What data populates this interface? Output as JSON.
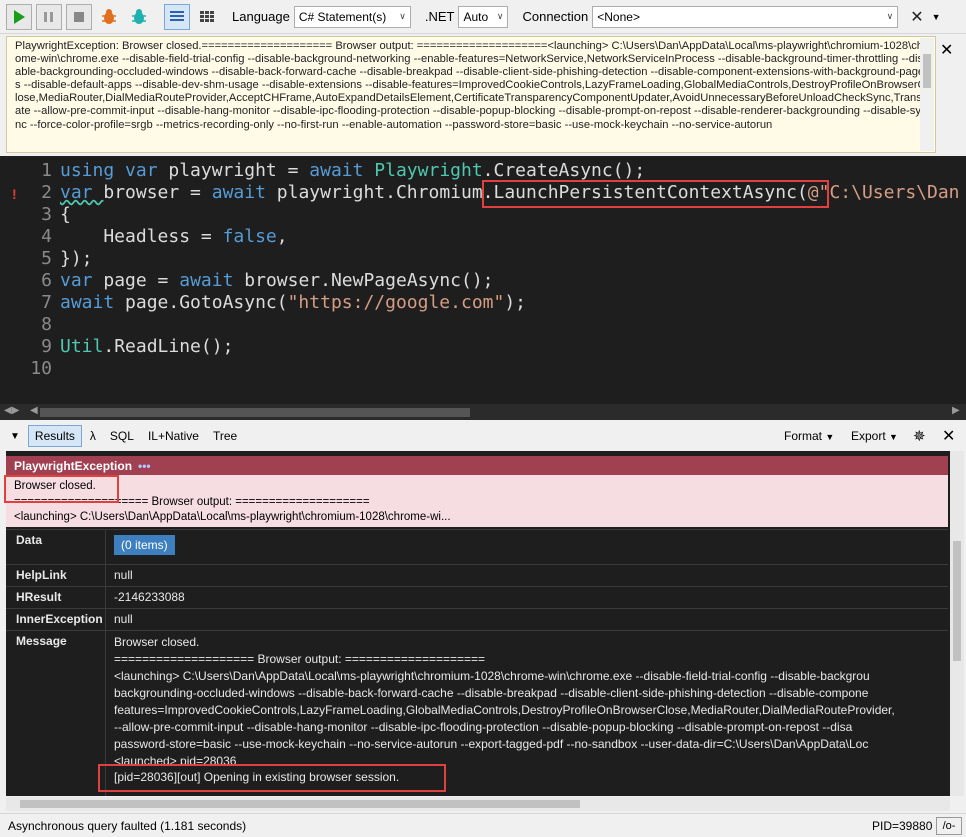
{
  "toolbar": {
    "language_label": "Language",
    "language_value": "C# Statement(s)",
    "dotnet_label": ".NET",
    "dotnet_value": "Auto",
    "connection_label": "Connection",
    "connection_value": "<None>"
  },
  "error_text": "PlaywrightException: Browser closed.==================== Browser output: ====================<launching> C:\\Users\\Dan\\AppData\\Local\\ms-playwright\\chromium-1028\\chrome-win\\chrome.exe --disable-field-trial-config --disable-background-networking --enable-features=NetworkService,NetworkServiceInProcess --disable-background-timer-throttling --disable-backgrounding-occluded-windows --disable-back-forward-cache --disable-breakpad --disable-client-side-phishing-detection --disable-component-extensions-with-background-pages --disable-default-apps --disable-dev-shm-usage --disable-extensions --disable-features=ImprovedCookieControls,LazyFrameLoading,GlobalMediaControls,DestroyProfileOnBrowserClose,MediaRouter,DialMediaRouteProvider,AcceptCHFrame,AutoExpandDetailsElement,CertificateTransparencyComponentUpdater,AvoidUnnecessaryBeforeUnloadCheckSync,Translate --allow-pre-commit-input --disable-hang-monitor --disable-ipc-flooding-protection --disable-popup-blocking --disable-prompt-on-repost --disable-renderer-backgrounding --disable-sync --force-color-profile=srgb --metrics-recording-only --no-first-run --enable-automation --password-store=basic --use-mock-keychain --no-service-autorun",
  "code": {
    "line_numbers": [
      "1",
      "2",
      "3",
      "4",
      "5",
      "6",
      "7",
      "8",
      "9",
      "10"
    ],
    "l1": [
      "using var ",
      "playwright",
      " = ",
      "await ",
      "Playwright",
      ".CreateAsync();"
    ],
    "l2": [
      "var ",
      "browser",
      " = ",
      "await ",
      "playwright.Chromium.LaunchPersistentContextAsync(",
      "@\"C:\\Users\\Dan"
    ],
    "l3": "{",
    "l4": [
      "    Headless = ",
      "false",
      ","
    ],
    "l5": "});",
    "l6": [
      "var ",
      "page",
      " = ",
      "await ",
      "browser.NewPageAsync();"
    ],
    "l7": [
      "await ",
      "page.GotoAsync(",
      "\"https://google.com\"",
      ");"
    ],
    "l9": [
      "Util",
      ".ReadLine();"
    ]
  },
  "results_toolbar": {
    "tab_results": "Results",
    "tab_lambda": "λ",
    "tab_sql": "SQL",
    "tab_il": "IL+Native",
    "tab_tree": "Tree",
    "format_label": "Format",
    "export_label": "Export"
  },
  "exception": {
    "header": "PlaywrightException",
    "header_dots": "•••",
    "summary_line1": "Browser closed.",
    "summary_line2": "==================== Browser output: ====================",
    "summary_line3": "<launching> C:\\Users\\Dan\\AppData\\Local\\ms-playwright\\chromium-1028\\chrome-wi...",
    "props": {
      "data_key": "Data",
      "data_value": "(0 items)",
      "helplink_key": "HelpLink",
      "helplink_value": "null",
      "hresult_key": "HResult",
      "hresult_value": "-2146233088",
      "inner_key": "InnerException",
      "inner_value": "null",
      "message_key": "Message",
      "message_lines": [
        "Browser closed.",
        "==================== Browser output: ====================",
        "<launching> C:\\Users\\Dan\\AppData\\Local\\ms-playwright\\chromium-1028\\chrome-win\\chrome.exe --disable-field-trial-config --disable-backgrou",
        "backgrounding-occluded-windows --disable-back-forward-cache --disable-breakpad --disable-client-side-phishing-detection --disable-compone",
        "features=ImprovedCookieControls,LazyFrameLoading,GlobalMediaControls,DestroyProfileOnBrowserClose,MediaRouter,DialMediaRouteProvider,",
        "--allow-pre-commit-input --disable-hang-monitor --disable-ipc-flooding-protection --disable-popup-blocking --disable-prompt-on-repost --disa",
        "password-store=basic --use-mock-keychain --no-service-autorun --export-tagged-pdf --no-sandbox --user-data-dir=C:\\Users\\Dan\\AppData\\Loc",
        "<launched> pid=28036",
        "[pid=28036][out] Opening in existing browser session."
      ]
    }
  },
  "status": {
    "text": "Asynchronous query faulted  (1.181 seconds)",
    "pid": "PID=39880",
    "btn": "/o-"
  }
}
